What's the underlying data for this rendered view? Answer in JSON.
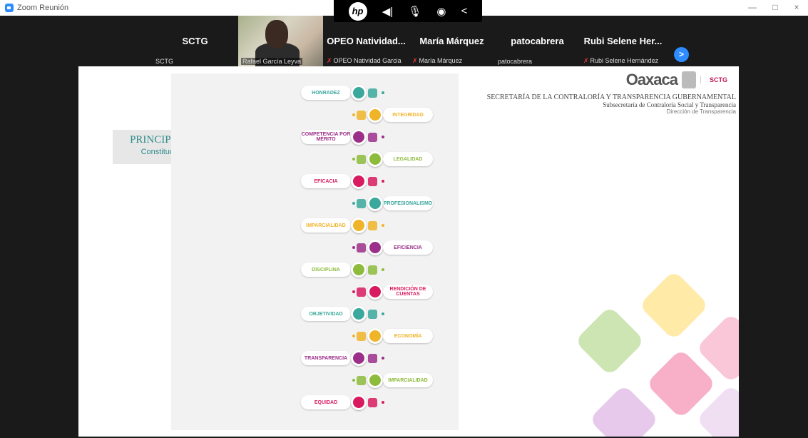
{
  "window": {
    "title": "Zoom Reunión",
    "min": "—",
    "max": "□",
    "close": "×"
  },
  "toolbar": {
    "hp": "hp",
    "speaker_icon": "speaker-icon",
    "mic_icon": "mic-icon",
    "wireless_icon": "wireless-icon",
    "collapse": "<"
  },
  "participants": [
    {
      "name": "SCTG",
      "label": "SCTG",
      "muted": false
    },
    {
      "name": "",
      "label": "Rafael García Leyva",
      "muted": false
    },
    {
      "name": "OPEO  Natividad...",
      "label": "OPEO Natividad Garcia",
      "muted": true
    },
    {
      "name": "María Márquez",
      "label": "María Márquez",
      "muted": true
    },
    {
      "name": "patocabrera",
      "label": "patocabrera",
      "muted": false
    },
    {
      "name": "Rubi  Selene  Her...",
      "label": "Rubi Selene Hernández",
      "muted": true
    }
  ],
  "next_arrow": ">",
  "slide": {
    "title": "PRINCIPIOS RECTORES",
    "subtitle": "Constitucionales y Legales",
    "brand": "Oaxaca",
    "brand_small": "SCTG",
    "org": "SECRETARÍA DE LA CONTRALORÍA Y TRANSPARENCIA GUBERNAMENTAL",
    "suborg": "Subsecretaría de Contraloría Social y Transparencia",
    "dept": "Dirección de Transparencia",
    "principles": [
      {
        "label": "HONRADEZ",
        "side": "left",
        "color": "#3aa89c"
      },
      {
        "label": "INTEGRIDAD",
        "side": "right",
        "color": "#f0b429"
      },
      {
        "label": "COMPETENCIA POR MÉRITO",
        "side": "left",
        "color": "#9c2f8a"
      },
      {
        "label": "LEGALIDAD",
        "side": "right",
        "color": "#8dbb3c"
      },
      {
        "label": "EFICACIA",
        "side": "left",
        "color": "#d81b60"
      },
      {
        "label": "PROFESIONALISMO",
        "side": "right",
        "color": "#3aa89c"
      },
      {
        "label": "IMPARCIALIDAD",
        "side": "left",
        "color": "#f0b429"
      },
      {
        "label": "EFICIENCIA",
        "side": "right",
        "color": "#9c2f8a"
      },
      {
        "label": "DISCIPLINA",
        "side": "left",
        "color": "#8dbb3c"
      },
      {
        "label": "RENDICIÓN DE CUENTAS",
        "side": "right",
        "color": "#d81b60"
      },
      {
        "label": "OBJETIVIDAD",
        "side": "left",
        "color": "#3aa89c"
      },
      {
        "label": "ECONOMÍA",
        "side": "right",
        "color": "#f0b429"
      },
      {
        "label": "TRANSPARENCIA",
        "side": "left",
        "color": "#9c2f8a"
      },
      {
        "label": "IMPARCIALIDAD",
        "side": "right",
        "color": "#8dbb3c"
      },
      {
        "label": "EQUIDAD",
        "side": "left",
        "color": "#d81b60"
      }
    ]
  }
}
